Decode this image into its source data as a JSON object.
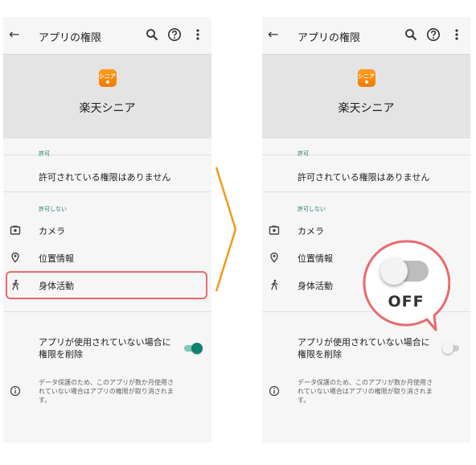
{
  "colors": {
    "accent": "#0f8272",
    "highlight": "#e96a6e",
    "arrow": "#f39a1b",
    "app_icon": "#f58c0a"
  },
  "screen_before": {
    "toolbar": {
      "back_icon": "arrow-back-icon",
      "title": "アプリの権限",
      "search_icon": "search-icon",
      "help_icon": "help-icon",
      "more_icon": "more-vert-icon"
    },
    "app": {
      "icon_text": "シニア",
      "name": "楽天シニア"
    },
    "allowed": {
      "label": "許可",
      "empty_text": "許可されている権限はありません"
    },
    "denied": {
      "label": "許可しない",
      "items": [
        {
          "label": "カメラ",
          "icon": "camera-icon"
        },
        {
          "label": "位置情報",
          "icon": "location-icon"
        },
        {
          "label": "身体活動",
          "icon": "walk-icon"
        }
      ]
    },
    "remove_setting": {
      "line1": "アプリが使用されていない場合に",
      "line2": "権限を削除",
      "enabled": true
    },
    "info": {
      "icon": "info-icon",
      "line1": "データ保護のため、このアプリが数か月使用さ",
      "line2": "れていない場合はアプリの権限が取り消されま",
      "line3": "す。"
    }
  },
  "screen_after": {
    "toolbar": {
      "back_icon": "arrow-back-icon",
      "title": "アプリの権限",
      "search_icon": "search-icon",
      "help_icon": "help-icon",
      "more_icon": "more-vert-icon"
    },
    "app": {
      "icon_text": "シニア",
      "name": "楽天シニア"
    },
    "allowed": {
      "label": "許可",
      "empty_text": "許可されている権限はありません"
    },
    "denied": {
      "label": "許可しない",
      "items": [
        {
          "label": "カメラ",
          "icon": "camera-icon"
        },
        {
          "label": "位置情報",
          "icon": "location-icon"
        },
        {
          "label": "身体活動",
          "icon": "walk-icon"
        }
      ]
    },
    "remove_setting": {
      "line1": "アプリが使用されていない場合に",
      "line2": "権限を削除",
      "enabled": false
    },
    "info": {
      "icon": "info-icon",
      "line1": "データ保護のため、このアプリが数か月使用さ",
      "line2": "れていない場合はアプリの権限が取り消されま",
      "line3": "す。"
    }
  },
  "callout": {
    "label": "OFF"
  }
}
